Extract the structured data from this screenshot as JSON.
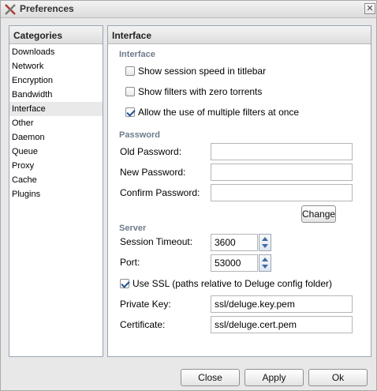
{
  "window": {
    "title": "Preferences",
    "close_glyph": "✕"
  },
  "categories": {
    "header": "Categories",
    "items": [
      "Downloads",
      "Network",
      "Encryption",
      "Bandwidth",
      "Interface",
      "Other",
      "Daemon",
      "Queue",
      "Proxy",
      "Cache",
      "Plugins"
    ],
    "selected": "Interface"
  },
  "main": {
    "header": "Interface",
    "interface": {
      "title": "Interface",
      "options": [
        {
          "label": "Show session speed in titlebar",
          "checked": false
        },
        {
          "label": "Show filters with zero torrents",
          "checked": false
        },
        {
          "label": "Allow the use of multiple filters at once",
          "checked": true
        }
      ]
    },
    "password": {
      "title": "Password",
      "old_label": "Old Password:",
      "new_label": "New Password:",
      "confirm_label": "Confirm Password:",
      "old_value": "",
      "new_value": "",
      "confirm_value": "",
      "change_label": "Change"
    },
    "server": {
      "title": "Server",
      "session_timeout_label": "Session Timeout:",
      "session_timeout_value": "3600",
      "port_label": "Port:",
      "port_value": "53000",
      "use_ssl_label": "Use SSL (paths relative to Deluge config folder)",
      "use_ssl_checked": true,
      "private_key_label": "Private Key:",
      "private_key_value": "ssl/deluge.key.pem",
      "certificate_label": "Certificate:",
      "certificate_value": "ssl/deluge.cert.pem"
    }
  },
  "footer": {
    "close_label": "Close",
    "apply_label": "Apply",
    "ok_label": "Ok"
  },
  "icons": {
    "app_icon": "crossed-tools-icon",
    "close_icon": "close-icon",
    "spin_up": "arrow-up-icon",
    "spin_down": "arrow-down-icon"
  }
}
